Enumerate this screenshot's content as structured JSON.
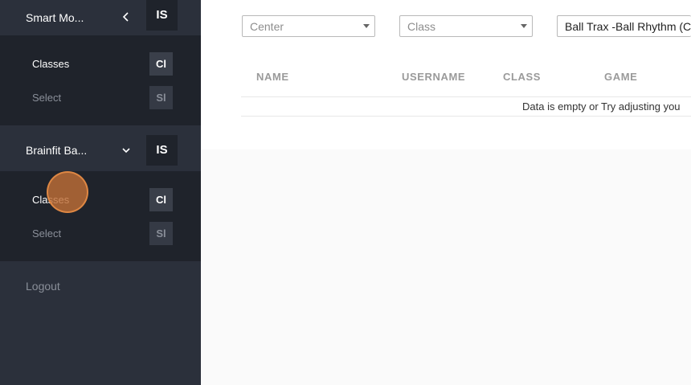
{
  "sidebar": {
    "groups": [
      {
        "title": "Smart Mo...",
        "badge": "IS",
        "items": [
          {
            "label": "Classes",
            "badge": "Cl"
          },
          {
            "label": "Select",
            "badge": "Sl"
          }
        ]
      },
      {
        "title": "Brainfit Ba...",
        "badge": "IS",
        "items": [
          {
            "label": "Classes",
            "badge": "Cl"
          },
          {
            "label": "Select",
            "badge": "Sl"
          }
        ]
      }
    ],
    "logout_label": "Logout"
  },
  "filters": {
    "center_placeholder": "Center",
    "class_placeholder": "Class",
    "game_value": "Ball Trax -Ball Rhythm (C"
  },
  "table": {
    "columns": [
      "NAME",
      "USERNAME",
      "CLASS",
      "GAME"
    ],
    "empty_message": "Data is empty or Try adjusting you"
  },
  "colors": {
    "sidebar_bg": "#2b303b",
    "subpanel_bg": "#1f232b",
    "click_marker": "#be6e37"
  }
}
